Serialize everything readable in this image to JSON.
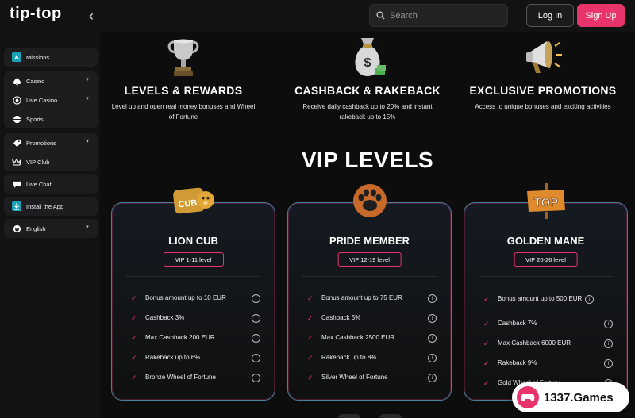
{
  "header": {
    "logo_text": "tip-top",
    "back_icon": "chevron-left-icon",
    "search_placeholder": "Search",
    "login_label": "Log In",
    "signup_label": "Sign Up"
  },
  "sidebar": {
    "groups": [
      {
        "items": [
          {
            "label": "Missions",
            "icon": "rocket-icon"
          }
        ]
      },
      {
        "items": [
          {
            "label": "Casino",
            "icon": "spade-icon",
            "chevron": true
          },
          {
            "label": "Live Casino",
            "icon": "chip-icon",
            "chevron": true
          },
          {
            "label": "Sports",
            "icon": "ball-icon"
          }
        ]
      },
      {
        "items": [
          {
            "label": "Promotions",
            "icon": "tag-icon",
            "chevron": true
          },
          {
            "label": "VIP Club",
            "icon": "crown-icon"
          }
        ]
      },
      {
        "items": [
          {
            "label": "Live Chat",
            "icon": "chat-icon"
          }
        ]
      },
      {
        "items": [
          {
            "label": "Install the App",
            "icon": "download-icon"
          }
        ]
      },
      {
        "items": [
          {
            "label": "English",
            "icon": "globe-icon",
            "chevron": true
          }
        ]
      }
    ]
  },
  "features": [
    {
      "title": "LEVELS & REWARDS",
      "description": "Level up and open real money bonuses and Wheel of Fortune",
      "icon": "trophy-icon"
    },
    {
      "title": "CASHBACK & RAKEBACK",
      "description": "Receive daily cashback up to 20% and instant rakeback up to 15%",
      "icon": "money-bag-icon"
    },
    {
      "title": "EXCLUSIVE PROMOTIONS",
      "description": "Access to unique bonuses and exciting activities",
      "icon": "megaphone-icon"
    }
  ],
  "vip_title": "VIP LEVELS",
  "vip_cards": [
    {
      "name": "LION CUB",
      "level": "VIP 1-11 level",
      "badge_text": "CUB",
      "icon": "lion-cub-badge-icon",
      "perks": [
        "Bonus amount up to 10 EUR",
        "Cashback 3%",
        "Max Cashback 200 EUR",
        "Rakeback up to 6%",
        "Bronze Wheel of Fortune"
      ]
    },
    {
      "name": "PRIDE MEMBER",
      "level": "VIP 12-19 level",
      "icon": "paw-icon",
      "perks": [
        "Bonus amount up to 75 EUR",
        "Cashback 5%",
        "Max Cashback 2500 EUR",
        "Rakeback up to 8%",
        "Silver Wheel of Fortune"
      ]
    },
    {
      "name": "GOLDEN MANE",
      "level": "VIP 20-26 level",
      "badge_text": "TOP",
      "icon": "top-sign-icon",
      "perks": [
        "Bonus amount up to 500 EUR",
        "Cashback 7%",
        "Max Cashback 6000 EUR",
        "Rakeback 9%",
        "Gold Wheel of Fortune"
      ]
    }
  ],
  "watermark": {
    "text": "1337.Games"
  },
  "colors": {
    "accent": "#e8336b",
    "card_border": "#4a7f9a",
    "background": "#0d0d0d"
  }
}
